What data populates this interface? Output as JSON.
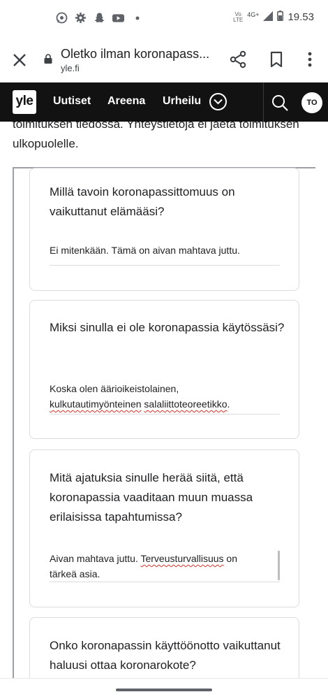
{
  "status_bar": {
    "time": "19.53",
    "network": "4G+",
    "volte_top": "Vo",
    "volte_bottom": "LTE",
    "left_icons": [
      "whatsapp-icon",
      "gear-icon",
      "snapchat-icon",
      "youtube-icon",
      "dot-icon"
    ]
  },
  "toolbar": {
    "title": "Oletko ilman koronapass...",
    "url": "yle.fi"
  },
  "nav": {
    "logo": "yle",
    "items": [
      "Uutiset",
      "Areena",
      "Urheilu"
    ],
    "avatar_initials": "TO"
  },
  "content": {
    "intro_text": "toimituksen tiedossa. Yhteystietoja ei jaeta toimituksen ulkopuolelle.",
    "cards": [
      {
        "question": "Millä tavoin koronapassittomuus on vaikuttanut elämääsi?",
        "answer": "Ei mitenkään. Tämä on aivan mahtava juttu."
      },
      {
        "question": "Miksi sinulla ei ole koronapassia käytössäsi?",
        "answer_line1": "Koska olen äärioikeistolainen,",
        "answer_line2_w1": "kulkutautimyönteinen",
        "answer_line2_w2": "salaliittoteoreetikko",
        "answer_line2_end": "."
      },
      {
        "question": "Mitä ajatuksia sinulle herää siitä, että koronapassia vaaditaan muun muassa erilaisissa tapahtumissa?",
        "answer_line1_start": "Aivan mahtava juttu. ",
        "answer_line1_word": "Terveusturvallisuus",
        "answer_line1_end": " on",
        "answer_line2": "tärkeä asia."
      },
      {
        "question": "Onko koronapassin käyttöönotto vaikuttanut haluusi ottaa koronarokote?"
      }
    ]
  },
  "colors": {
    "nav_bg": "#121212",
    "spellcheck": "#d93025",
    "card_border": "#dadce0"
  }
}
